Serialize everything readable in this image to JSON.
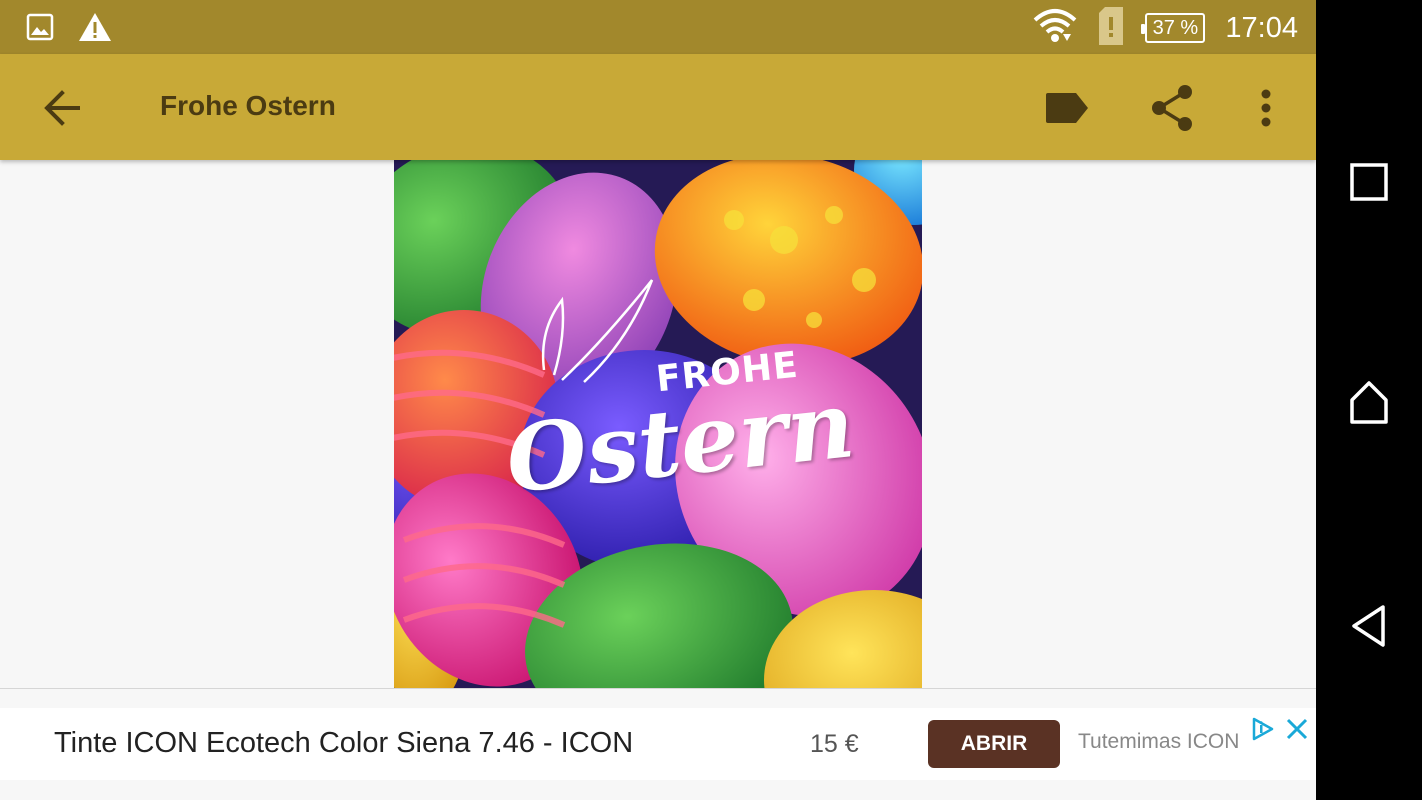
{
  "status_bar": {
    "icons": [
      "image-notification-icon",
      "warning-icon",
      "wifi-icon",
      "sim-alert-icon"
    ],
    "battery": "37 %",
    "time": "17:04",
    "color": "#a2882c"
  },
  "toolbar": {
    "title": "Frohe Ostern",
    "color": "#c8a937",
    "icons": [
      "back-arrow-icon",
      "label-icon",
      "share-icon",
      "more-vert-icon"
    ]
  },
  "image": {
    "text_line1": "FROHE",
    "text_line2": "Ostern"
  },
  "ad": {
    "title": "Tinte ICON Ecotech Color Siena 7.46 - ICON",
    "price": "15 €",
    "button": "ABRIR",
    "advertiser": "Tutemimas ICON",
    "button_color": "#5a3224",
    "icons": [
      "ad-choices-icon",
      "close-icon"
    ]
  },
  "nav_bar": {
    "icons": [
      "recents-icon",
      "home-icon",
      "back-icon"
    ]
  }
}
